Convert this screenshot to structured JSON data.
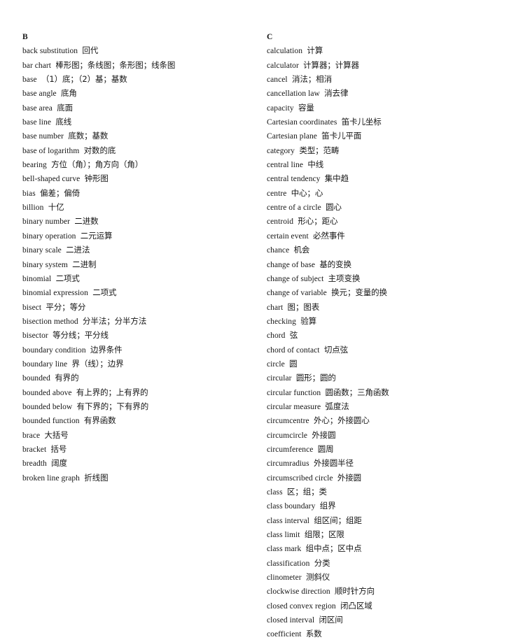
{
  "document": {
    "type": "bilingual-glossary",
    "language_pair": "English-Chinese",
    "text_color": "#161616",
    "background_color": "#ffffff"
  },
  "columns": [
    {
      "id": "column-b",
      "section_letter": "B",
      "entries": [
        {
          "term": "back substitution",
          "gloss": "回代"
        },
        {
          "term": "bar chart",
          "gloss": "棒形图；条线图；条形图；线条图"
        },
        {
          "term": "base",
          "gloss": "（1）底；（2）基；基数"
        },
        {
          "term": "base angle",
          "gloss": "底角"
        },
        {
          "term": "base area",
          "gloss": "底面"
        },
        {
          "term": "base line",
          "gloss": "底线"
        },
        {
          "term": "base number",
          "gloss": "底数；基数"
        },
        {
          "term": "base of logarithm",
          "gloss": "对数的底"
        },
        {
          "term": "bearing",
          "gloss": "方位（角）；角方向（角）"
        },
        {
          "term": "bell-shaped curve",
          "gloss": "钟形图"
        },
        {
          "term": "bias",
          "gloss": "偏差；偏倚"
        },
        {
          "term": "billion",
          "gloss": "十亿"
        },
        {
          "term": "binary number",
          "gloss": "二进数"
        },
        {
          "term": "binary operation",
          "gloss": "二元运算"
        },
        {
          "term": "binary scale",
          "gloss": "二进法"
        },
        {
          "term": "binary system",
          "gloss": "二进制"
        },
        {
          "term": "binomial",
          "gloss": "二项式"
        },
        {
          "term": "binomial expression",
          "gloss": "二项式"
        },
        {
          "term": "bisect",
          "gloss": "平分；等分"
        },
        {
          "term": "bisection method",
          "gloss": "分半法；分半方法"
        },
        {
          "term": "bisector",
          "gloss": "等分线；平分线"
        },
        {
          "term": "boundary condition",
          "gloss": "边界条件"
        },
        {
          "term": "boundary line",
          "gloss": "界（线）；边界"
        },
        {
          "term": "bounded",
          "gloss": "有界的"
        },
        {
          "term": "bounded above",
          "gloss": "有上界的；上有界的"
        },
        {
          "term": "bounded below",
          "gloss": "有下界的；下有界的"
        },
        {
          "term": "bounded function",
          "gloss": "有界函数"
        },
        {
          "term": "brace",
          "gloss": "大括号"
        },
        {
          "term": "bracket",
          "gloss": "括号"
        },
        {
          "term": "breadth",
          "gloss": "阔度"
        },
        {
          "term": "broken line graph",
          "gloss": "折线图"
        }
      ]
    },
    {
      "id": "column-c",
      "section_letter": "C",
      "entries": [
        {
          "term": "calculation",
          "gloss": "计算"
        },
        {
          "term": "calculator",
          "gloss": "计算器；计算器"
        },
        {
          "term": "cancel",
          "gloss": "消法；相消"
        },
        {
          "term": "cancellation law",
          "gloss": "消去律"
        },
        {
          "term": "capacity",
          "gloss": "容量"
        },
        {
          "term": "Cartesian coordinates",
          "gloss": "笛卡儿坐标"
        },
        {
          "term": "Cartesian plane",
          "gloss": "笛卡儿平面"
        },
        {
          "term": "category",
          "gloss": "类型；范畴"
        },
        {
          "term": "central line",
          "gloss": "中线"
        },
        {
          "term": "central tendency",
          "gloss": "集中趋"
        },
        {
          "term": "centre",
          "gloss": "中心；心"
        },
        {
          "term": "centre of a circle",
          "gloss": "圆心"
        },
        {
          "term": "centroid",
          "gloss": "形心；距心"
        },
        {
          "term": "certain event",
          "gloss": "必然事件"
        },
        {
          "term": "chance",
          "gloss": "机会"
        },
        {
          "term": "change of base",
          "gloss": "基的变换"
        },
        {
          "term": "change of subject",
          "gloss": "主项变换"
        },
        {
          "term": "change of variable",
          "gloss": "换元；变量的换"
        },
        {
          "term": "chart",
          "gloss": "图；图表"
        },
        {
          "term": "checking",
          "gloss": "验算"
        },
        {
          "term": "chord",
          "gloss": "弦"
        },
        {
          "term": "chord of contact",
          "gloss": "切点弦"
        },
        {
          "term": "circle",
          "gloss": "圆"
        },
        {
          "term": "circular",
          "gloss": "圆形；圆的"
        },
        {
          "term": "circular function",
          "gloss": "圆函数；三角函数"
        },
        {
          "term": "circular measure",
          "gloss": "弧度法"
        },
        {
          "term": "circumcentre",
          "gloss": "外心；外接圆心"
        },
        {
          "term": "circumcircle",
          "gloss": "外接圆"
        },
        {
          "term": "circumference",
          "gloss": "圆周"
        },
        {
          "term": "circumradius",
          "gloss": "外接圆半径"
        },
        {
          "term": "circumscribed circle",
          "gloss": "外接圆"
        },
        {
          "term": "class",
          "gloss": "区；组；类"
        },
        {
          "term": "class boundary",
          "gloss": "组界"
        },
        {
          "term": "class interval",
          "gloss": "组区间；组距"
        },
        {
          "term": "class limit",
          "gloss": "组限；区限"
        },
        {
          "term": "class mark",
          "gloss": "组中点；区中点"
        },
        {
          "term": "classification",
          "gloss": "分类"
        },
        {
          "term": "clinometer",
          "gloss": "测斜仪"
        },
        {
          "term": "clockwise direction",
          "gloss": "顺时针方向"
        },
        {
          "term": "closed convex region",
          "gloss": "闭凸区域"
        },
        {
          "term": "closed interval",
          "gloss": "闭区间"
        },
        {
          "term": "coefficient",
          "gloss": "系数"
        }
      ]
    }
  ]
}
